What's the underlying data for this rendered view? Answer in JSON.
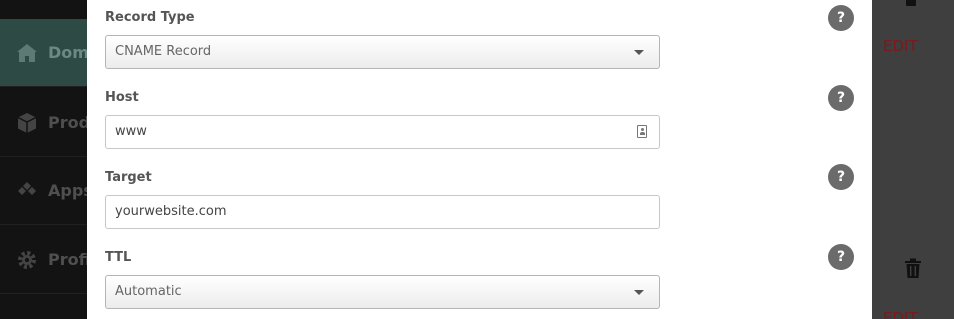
{
  "sidebar": {
    "items": [
      {
        "label": "Domains",
        "icon": "home-icon"
      },
      {
        "label": "Products",
        "icon": "box-icon"
      },
      {
        "label": "Apps",
        "icon": "apps-icon"
      },
      {
        "label": "Profile",
        "icon": "gear-icon"
      }
    ]
  },
  "background": {
    "edit_label_1": "EDIT",
    "edit_label_2": "EDIT"
  },
  "form": {
    "record_type": {
      "label": "Record Type",
      "value": "CNAME Record"
    },
    "host": {
      "label": "Host",
      "value": "www"
    },
    "target": {
      "label": "Target",
      "value": "yourwebsite.com"
    },
    "ttl": {
      "label": "TTL",
      "value": "Automatic"
    },
    "help_glyph": "?"
  },
  "colors": {
    "accent_active": "#2d4a44",
    "edit_red": "#7a1a1a",
    "help_bg": "#6b6b6b"
  }
}
